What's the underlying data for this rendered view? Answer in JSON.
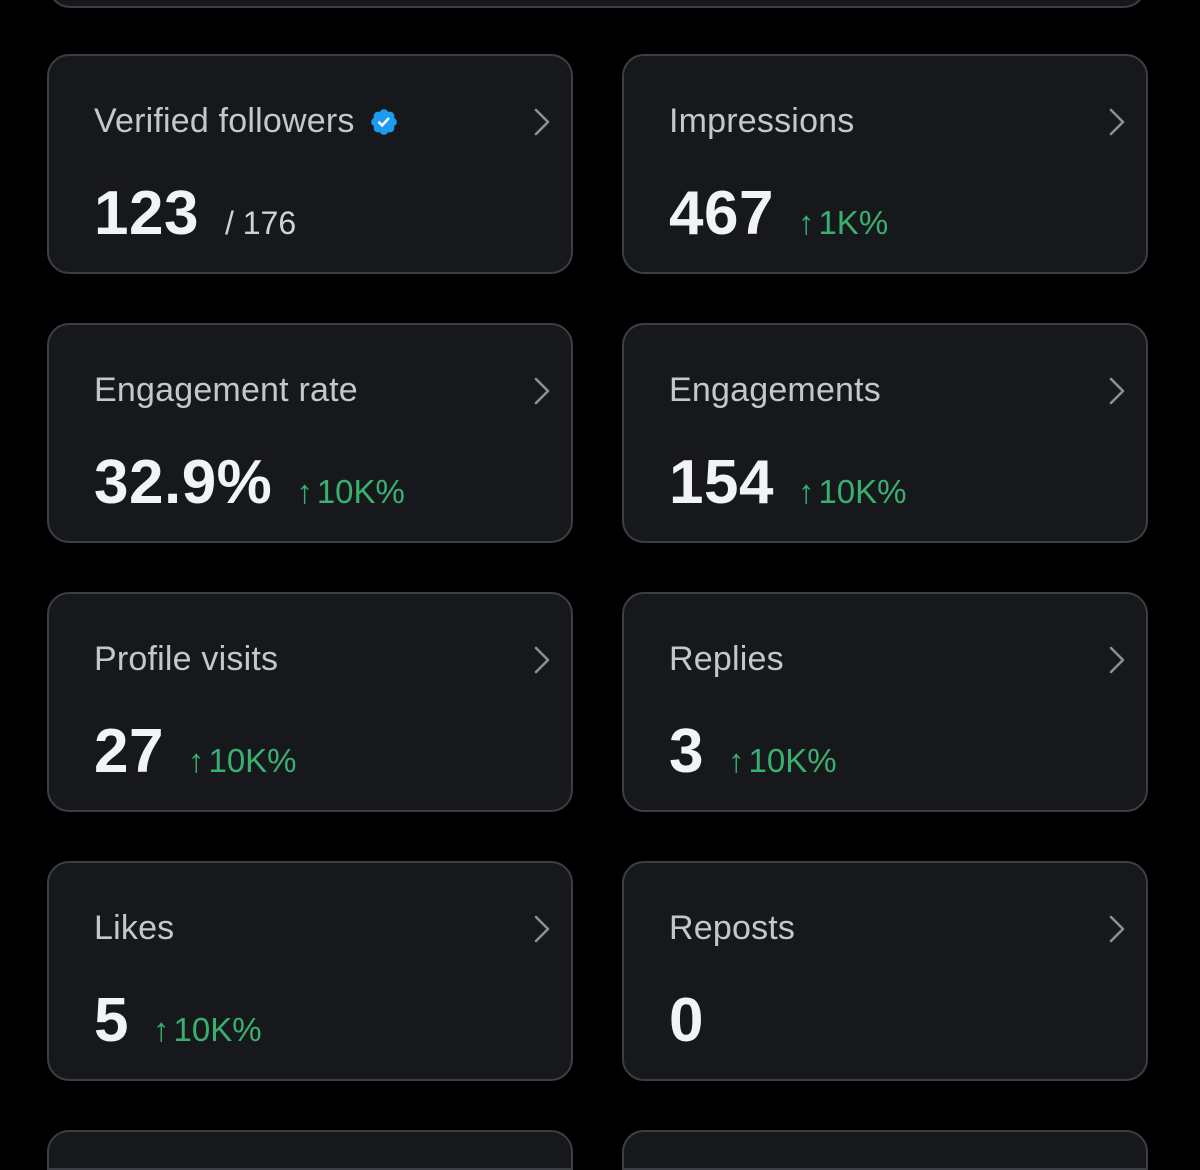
{
  "colors": {
    "background": "#000000",
    "card": "#16181c",
    "card_border": "#3b3f44",
    "label": "#c4c7cc",
    "value": "#f2f3f4",
    "positive_delta": "#38b070",
    "verified_badge": "#1d9bf0"
  },
  "cards": {
    "verified_followers": {
      "label": "Verified followers",
      "value": "123",
      "total": "/ 176",
      "icon": "verified-badge-icon"
    },
    "impressions": {
      "label": "Impressions",
      "value": "467",
      "delta": "1K%"
    },
    "engagement_rate": {
      "label": "Engagement rate",
      "value": "32.9%",
      "delta": "10K%"
    },
    "engagements": {
      "label": "Engagements",
      "value": "154",
      "delta": "10K%"
    },
    "profile_visits": {
      "label": "Profile visits",
      "value": "27",
      "delta": "10K%"
    },
    "replies": {
      "label": "Replies",
      "value": "3",
      "delta": "10K%"
    },
    "likes": {
      "label": "Likes",
      "value": "5",
      "delta": "10K%"
    },
    "reposts": {
      "label": "Reposts",
      "value": "0"
    }
  }
}
